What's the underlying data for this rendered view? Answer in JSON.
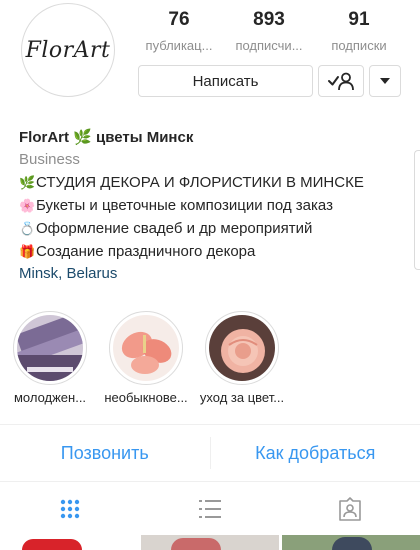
{
  "avatar": {
    "text": "FlorArt"
  },
  "stats": [
    {
      "value": "76",
      "label": "публикац..."
    },
    {
      "value": "893",
      "label": "подписчи..."
    },
    {
      "value": "91",
      "label": "подписки"
    }
  ],
  "buttons": {
    "message": "Написать"
  },
  "bio": {
    "name": "FlorArt 🌿 цветы Минск",
    "category": "Business",
    "lines": [
      {
        "emoji": "🌿",
        "text": "СТУДИЯ ДЕКОРА И ФЛОРИСТИКИ В МИНСКЕ"
      },
      {
        "emoji": "🌸",
        "text": "Букеты и цветочные композиции под заказ"
      },
      {
        "emoji": "💍",
        "text": "Оформление свадеб и др мероприятий"
      },
      {
        "emoji": "🎁",
        "text": "Создание праздничного декора"
      }
    ],
    "location": "Minsk, Belarus"
  },
  "highlights": [
    {
      "label": "молоджен..."
    },
    {
      "label": "необыкнове..."
    },
    {
      "label": "уход за цвет..."
    }
  ],
  "actions": {
    "call": "Позвонить",
    "directions": "Как добраться"
  },
  "colors": {
    "link": "#3897f0",
    "location": "#1b4a6b",
    "muted": "#8e8e8e",
    "border": "#dbdbdb"
  },
  "icons": [
    "person-check-icon",
    "chevron-down-icon",
    "grid-icon",
    "list-icon",
    "tagged-icon"
  ]
}
